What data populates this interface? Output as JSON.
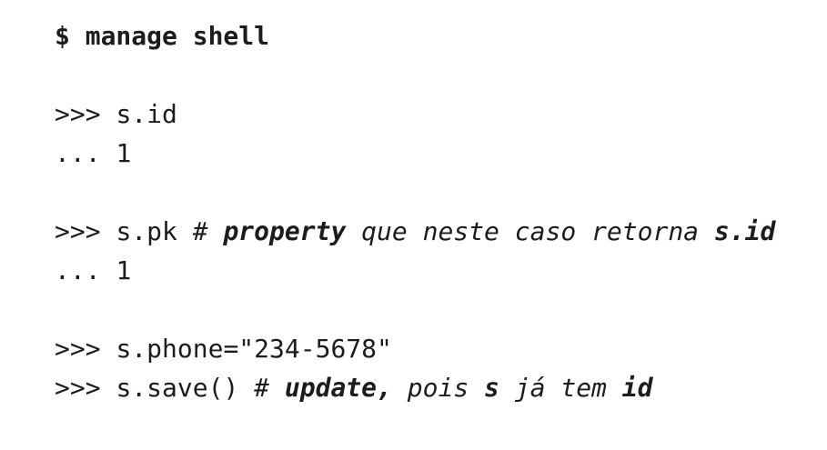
{
  "command": {
    "text": "$ manage shell"
  },
  "blocks": [
    {
      "lines": [
        {
          "prompt": ">>>",
          "code": "s.id"
        },
        {
          "prompt": "...",
          "code": "1"
        }
      ]
    },
    {
      "lines": [
        {
          "prompt": ">>>",
          "code": "s.pk",
          "comment": {
            "hash": "#",
            "bold1": "property",
            "text1": "que neste caso retorna",
            "bold2": "s.id"
          }
        },
        {
          "prompt": "...",
          "code": "1"
        }
      ]
    },
    {
      "lines": [
        {
          "prompt": ">>>",
          "code": "s.phone=\"234-5678\""
        },
        {
          "prompt": ">>>",
          "code": "s.save()",
          "comment": {
            "hash": "#",
            "bold1": "update,",
            "text1": "pois",
            "bold2": "s",
            "text2": "já tem",
            "bold3": "id"
          }
        }
      ]
    }
  ]
}
